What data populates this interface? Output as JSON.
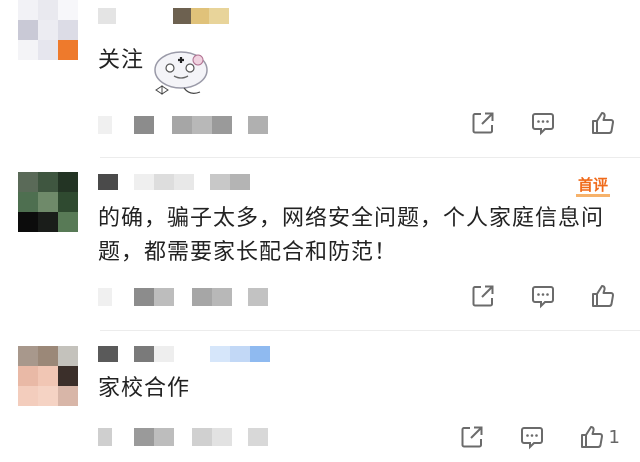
{
  "comments": [
    {
      "text": "关注",
      "has_sticker": true,
      "like_count": ""
    },
    {
      "badge": "首评",
      "text_lines": [
        "的确，骗子太多，网络安全问题，个人家庭信息问",
        "题，都需要家长配合和防范！"
      ],
      "like_count": ""
    },
    {
      "text": "家校合作",
      "like_count": "1"
    }
  ],
  "icons": {
    "share": "share-icon",
    "comment": "comment-icon",
    "like": "thumbs-up-icon",
    "sticker": "cartoon-sticker-icon"
  },
  "colors": {
    "badge_text": "#f06a1a",
    "badge_underline": "#f6b26b",
    "icon_gray": "#6b6b6b",
    "divider": "#ececec"
  }
}
